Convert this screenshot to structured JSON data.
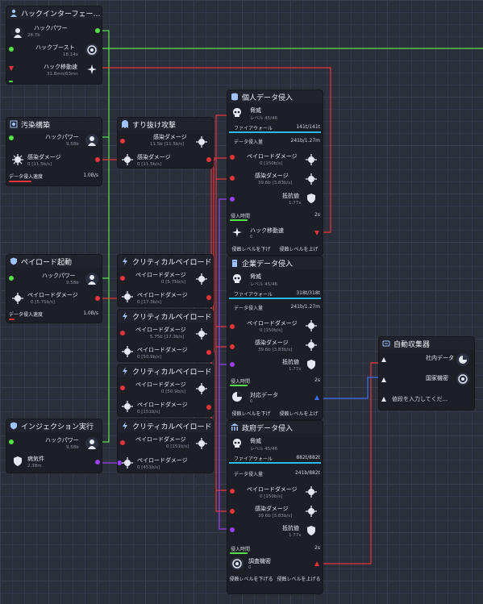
{
  "colors": {
    "green": "#56e04a",
    "red": "#e8343b",
    "purple": "#9b3ff0",
    "blue": "#3a6ff0",
    "cyan": "#2db8f0",
    "panel": "#1c1f26"
  },
  "hack_interface": {
    "title": "ハックインターフェー…",
    "hack_power_label": "ハックパワー",
    "hack_power_value": "28.7b",
    "hack_boost_label": "ハックブースト",
    "hack_boost_value": "18.14x",
    "hack_speed_label": "ハック移動速",
    "hack_speed_value": "31.8mn/63mn"
  },
  "infect": {
    "title": "汚染構築",
    "hack_power_label": "ハックパワー",
    "hack_power_value": "9.58b",
    "infect_damage_label": "感染ダメージ",
    "infect_damage_value": "0 [11.5b/s]",
    "data_speed_label": "データ侵入速度",
    "data_speed_value": "1.0B/s"
  },
  "rush": {
    "title": "すり抜け攻撃",
    "infect_damage_label": "感染ダメージ",
    "infect_damage_value": "11.5b [11.5b/s]",
    "infect_damage2_label": "感染ダメージ",
    "infect_damage2_value": "0 [11.5b/s]"
  },
  "payload": {
    "title": "ペイロード起動",
    "hack_power_label": "ハックパワー",
    "hack_power_value": "9.58b",
    "payload_damage_label": "ペイロードダメージ",
    "payload_damage_value": "0 [5.75b/s]",
    "data_speed_label": "データ侵入速度",
    "data_speed_value": "1.0B/s"
  },
  "critical": [
    {
      "title": "クリティカルペイロード",
      "in_label": "ペイロードダメージ",
      "in_value": "0 [5.75b/s]",
      "out_label": "ペイロードダメージ",
      "out_value": "0 [17.3b/s]"
    },
    {
      "title": "クリティカルペイロード",
      "in_label": "ペイロードダメージ",
      "in_value": "5.75b [17.3b/s]",
      "out_label": "ペイロードダメージ",
      "out_value": "0 [50.9b/s]"
    },
    {
      "title": "クリティカルペイロード",
      "in_label": "ペイロードダメージ",
      "in_value": "0 [50.9b/s]",
      "out_label": "ペイロードダメージ",
      "out_value": "0 [151b/s]"
    },
    {
      "title": "クリティカルペイロード",
      "in_label": "ペイロードダメージ",
      "in_value": "0 [151b/s]",
      "out_label": "ペイロードダメージ",
      "out_value": "0 [451b/s]"
    }
  ],
  "injection": {
    "title": "インジェクション実行",
    "hack_power_label": "ハックパワー",
    "hack_power_value": "9.58b",
    "virus_label": "病気件",
    "virus_value": "2.38m"
  },
  "targets": [
    {
      "title": "個人データ侵入",
      "target_label": "脅威",
      "target_level": "レベル 45/46",
      "firewall_label": "ファイアウォール",
      "firewall_value": "141t/141t",
      "data_label": "データ侵入量",
      "data_value": "241b/1.27m",
      "payload_label": "ペイロードダメージ",
      "payload_value": "0 [150b/s]",
      "infect_label": "感染ダメージ",
      "infect_value": "39.6b [3.83b/s]",
      "virus_label": "抵抗値",
      "virus_value": "1.77x",
      "time_label": "侵入時間",
      "time_value": "2s",
      "reward_label": "ハック移動速",
      "reward_value": "0",
      "btn_left": "侵蝕レベルを下げ",
      "btn_right": "侵蝕レベルを上げ"
    },
    {
      "title": "企業データ侵入",
      "target_label": "脅威",
      "target_level": "レベル 45/46",
      "firewall_label": "ファイアウォール",
      "firewall_value": "318t/318t",
      "data_label": "データ侵入量",
      "data_value": "241b/1.27m",
      "payload_label": "ペイロードダメージ",
      "payload_value": "0 [150b/s]",
      "infect_label": "感染ダメージ",
      "infect_value": "39.6b [3.83b/s]",
      "virus_label": "抵抗値",
      "virus_value": "1.77x",
      "time_label": "侵入時間",
      "time_value": "2s",
      "reward_label": "対応データ",
      "reward_value": "0",
      "btn_left": "侵蝕レベルを下げ",
      "btn_right": "侵蝕レベルを上げ"
    },
    {
      "title": "政府データ侵入",
      "target_label": "脅威",
      "target_level": "レベル 45/46",
      "firewall_label": "ファイアウォール",
      "firewall_value": "882t/882t",
      "data_label": "データ侵入量",
      "data_value": "241b/882t",
      "payload_label": "ペイロードダメージ",
      "payload_value": "0 [150b/s]",
      "infect_label": "感染ダメージ",
      "infect_value": "39.6b [3.83b/s]",
      "virus_label": "抵抗値",
      "virus_value": "1.77x",
      "time_label": "侵入時間",
      "time_value": "2s",
      "reward_label": "調査機密",
      "reward_value": "0",
      "btn_left": "侵蝕レベルを下げる",
      "btn_right": "侵蝕レベルを上げる"
    }
  ],
  "collector": {
    "title": "自動収集器",
    "in1_label": "社内データ",
    "in2_label": "国家機密",
    "input_placeholder": "値段を入力してくだ..."
  }
}
